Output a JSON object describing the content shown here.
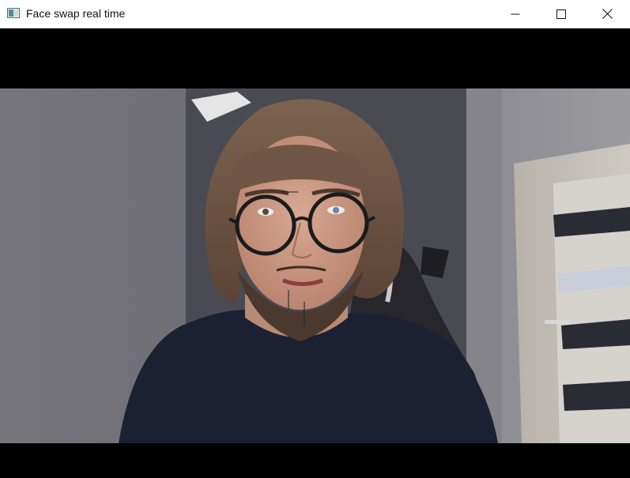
{
  "window": {
    "title": "Face swap real time",
    "icon": "app-window-icon",
    "controls": {
      "minimize_icon": "minimize-icon",
      "maximize_icon": "maximize-icon",
      "close_icon": "close-icon"
    }
  },
  "video": {
    "content": "webcam-frame"
  },
  "colors": {
    "titlebar": "#ffffff",
    "letterbox": "#000000",
    "close_hover": "#e81123"
  }
}
